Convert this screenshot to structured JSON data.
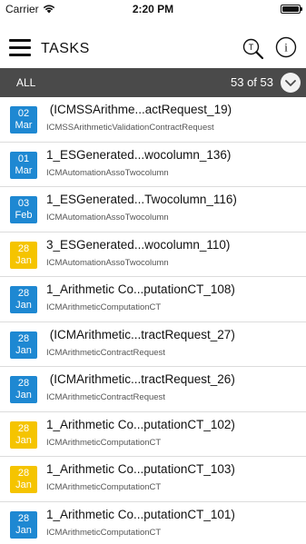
{
  "status_bar": {
    "carrier": "Carrier",
    "time": "2:20 PM",
    "battery_level": 1.0
  },
  "header": {
    "title": "TASKS",
    "menu_icon": "hamburger-icon",
    "task_search_icon": "task-search-icon",
    "task_search_glyph": "T",
    "info_icon": "info-icon",
    "info_glyph": "i"
  },
  "filter": {
    "label": "ALL",
    "count": "53 of 53"
  },
  "colors": {
    "blue": "#1e88d2",
    "yellow": "#f5c400",
    "filter_bg": "#4a4a4a"
  },
  "tasks": [
    {
      "day": "02",
      "month": "Mar",
      "color": "blue",
      "title": " (ICMSSArithme...actRequest_19)",
      "subtitle": "ICMSSArithmeticValidationContractRequest"
    },
    {
      "day": "01",
      "month": "Mar",
      "color": "blue",
      "title": "1_ESGenerated...wocolumn_136)",
      "subtitle": "ICMAutomationAssoTwocolumn"
    },
    {
      "day": "03",
      "month": "Feb",
      "color": "blue",
      "title": "1_ESGenerated...Twocolumn_116)",
      "subtitle": "ICMAutomationAssoTwocolumn"
    },
    {
      "day": "28",
      "month": "Jan",
      "color": "yellow",
      "title": "3_ESGenerated...wocolumn_110)",
      "subtitle": "ICMAutomationAssoTwocolumn"
    },
    {
      "day": "28",
      "month": "Jan",
      "color": "blue",
      "title": "1_Arithmetic Co...putationCT_108)",
      "subtitle": "ICMArithmeticComputationCT"
    },
    {
      "day": "28",
      "month": "Jan",
      "color": "blue",
      "title": " (ICMArithmetic...tractRequest_27)",
      "subtitle": "ICMArithmeticContractRequest"
    },
    {
      "day": "28",
      "month": "Jan",
      "color": "blue",
      "title": " (ICMArithmetic...tractRequest_26)",
      "subtitle": "ICMArithmeticContractRequest"
    },
    {
      "day": "28",
      "month": "Jan",
      "color": "yellow",
      "title": "1_Arithmetic Co...putationCT_102)",
      "subtitle": "ICMArithmeticComputationCT"
    },
    {
      "day": "28",
      "month": "Jan",
      "color": "yellow",
      "title": "1_Arithmetic Co...putationCT_103)",
      "subtitle": "ICMArithmeticComputationCT"
    },
    {
      "day": "28",
      "month": "Jan",
      "color": "blue",
      "title": "1_Arithmetic Co...putationCT_101)",
      "subtitle": "ICMArithmeticComputationCT"
    }
  ]
}
